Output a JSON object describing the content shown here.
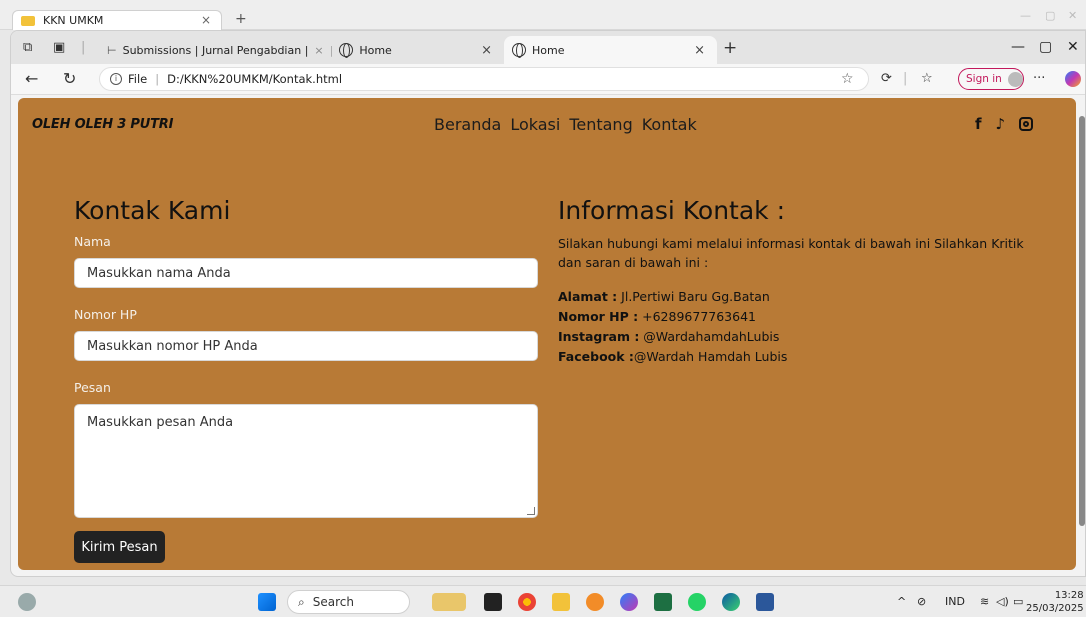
{
  "bg_window": {
    "tab_title": "KKN UMKM"
  },
  "browser": {
    "tabs": [
      {
        "label": "Submissions | Jurnal Pengabdian |"
      },
      {
        "label": "Home"
      },
      {
        "label": "Home"
      }
    ],
    "url_prefix": "File",
    "url": "D:/KKN%20UMKM/Kontak.html",
    "signin_label": "Sign in"
  },
  "site": {
    "brand": "OLEH OLEH 3 PUTRI",
    "nav": [
      "Beranda",
      "Lokasi",
      "Tentang",
      "Kontak"
    ],
    "social_icons": [
      "facebook-icon",
      "tiktok-icon",
      "instagram-icon"
    ]
  },
  "form": {
    "heading": "Kontak Kami",
    "name_label": "Nama",
    "name_placeholder": "Masukkan nama Anda",
    "phone_label": "Nomor HP",
    "phone_placeholder": "Masukkan nomor HP Anda",
    "message_label": "Pesan",
    "message_placeholder": "Masukkan pesan Anda",
    "submit_label": "Kirim Pesan"
  },
  "contact_info": {
    "heading": "Informasi Kontak :",
    "intro": "Silakan hubungi kami melalui informasi kontak di bawah ini Silahkan Kritik dan saran di bawah ini :",
    "alamat_label": "Alamat :",
    "alamat_value": " Jl.Pertiwi Baru Gg.Batan",
    "hp_label": "Nomor HP :",
    "hp_value": " +6289677763641",
    "instagram_label": "Instagram :",
    "instagram_value": " @WardahamdahLubis",
    "facebook_label": "Facebook :",
    "facebook_value": "@Wardah Hamdah Lubis"
  },
  "taskbar": {
    "search_label": "Search",
    "lang": "IND",
    "time": "13:28",
    "date": "25/03/2025"
  },
  "colors": {
    "page_bg": "#b87a36",
    "button_bg": "#222222"
  }
}
